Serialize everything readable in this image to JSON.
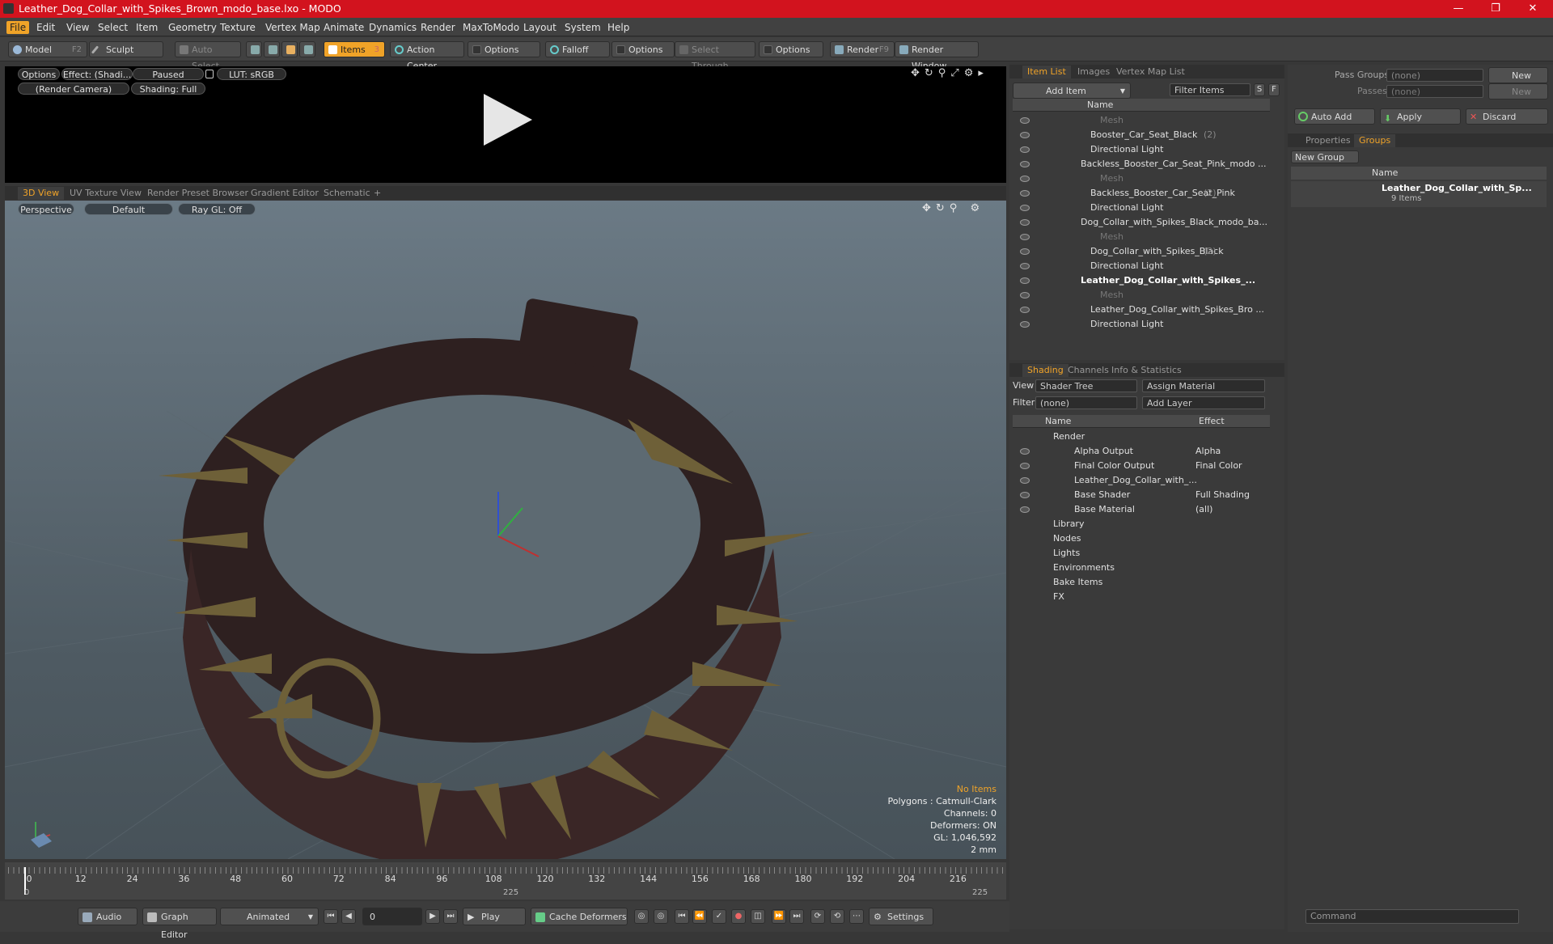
{
  "window": {
    "title": "Leather_Dog_Collar_with_Spikes_Brown_modo_base.lxo - MODO",
    "min": "—",
    "max": "❐",
    "close": "✕"
  },
  "menu": [
    "File",
    "Edit",
    "View",
    "Select",
    "Item",
    "Geometry",
    "Texture",
    "Vertex Map",
    "Animate",
    "Dynamics",
    "Render",
    "MaxToModo",
    "Layout",
    "System",
    "Help"
  ],
  "toolbar": {
    "model": "Model",
    "model_key": "F2",
    "sculpt": "Sculpt",
    "auto_select": "Auto Select",
    "items": "Items",
    "items_key": "3",
    "action_center": "Action Center",
    "options1": "Options",
    "falloff": "Falloff",
    "options2": "Options",
    "select_through": "Select Through",
    "options3": "Options",
    "render": "Render",
    "render_key": "F9",
    "render_window": "Render Window"
  },
  "render_view": {
    "options": "Options",
    "effect": "Effect: (Shadi...",
    "paused": "Paused",
    "lut": "LUT: sRGB",
    "camera": "(Render Camera)",
    "shading": "Shading: Full"
  },
  "view_tabs": [
    "3D View",
    "UV Texture View",
    "Render Preset Browser",
    "Gradient Editor",
    "Schematic"
  ],
  "viewport": {
    "projection": "Perspective",
    "style": "Default",
    "raygl": "Ray GL: Off",
    "stats": {
      "no_items": "No Items",
      "polygons": "Polygons : Catmull-Clark",
      "channels": "Channels: 0",
      "deformers": "Deformers: ON",
      "gl": "GL: 1,046,592",
      "scale": "2 mm"
    }
  },
  "timeline": {
    "major": [
      "0",
      "12",
      "24",
      "36",
      "48",
      "60",
      "72",
      "84",
      "96",
      "108",
      "120",
      "132",
      "144",
      "156",
      "168",
      "180",
      "192",
      "204",
      "216"
    ],
    "start": "0",
    "mid": "225",
    "end": "225"
  },
  "bottom": {
    "audio": "Audio",
    "graph_editor": "Graph Editor",
    "animated": "Animated",
    "frame": "0",
    "play": "Play",
    "cache": "Cache Deformers",
    "settings": "Settings"
  },
  "item_list": {
    "tabs": [
      "Item List",
      "Images",
      "Vertex Map List"
    ],
    "add_item": "Add Item",
    "filter": "Filter Items",
    "s": "S",
    "f": "F",
    "col_name": "Name",
    "rows": [
      {
        "label": "Mesh",
        "indent": 3,
        "style": "dim"
      },
      {
        "label": "Booster_Car_Seat_Black",
        "count": "(2)",
        "indent": 2,
        "style": ""
      },
      {
        "label": "Directional Light",
        "indent": 2,
        "style": ""
      },
      {
        "label": "Backless_Booster_Car_Seat_Pink_modo ...",
        "indent": 1,
        "style": ""
      },
      {
        "label": "Mesh",
        "indent": 3,
        "style": "dim"
      },
      {
        "label": "Backless_Booster_Car_Seat_Pink",
        "count": "(2)",
        "indent": 2,
        "style": ""
      },
      {
        "label": "Directional Light",
        "indent": 2,
        "style": ""
      },
      {
        "label": "Dog_Collar_with_Spikes_Black_modo_ba...",
        "indent": 1,
        "style": ""
      },
      {
        "label": "Mesh",
        "indent": 3,
        "style": "dim"
      },
      {
        "label": "Dog_Collar_with_Spikes_Black",
        "count": "(2)",
        "indent": 2,
        "style": ""
      },
      {
        "label": "Directional Light",
        "indent": 2,
        "style": ""
      },
      {
        "label": "Leather_Dog_Collar_with_Spikes_...",
        "indent": 1,
        "style": "bold"
      },
      {
        "label": "Mesh",
        "indent": 3,
        "style": "dim"
      },
      {
        "label": "Leather_Dog_Collar_with_Spikes_Bro ...",
        "indent": 2,
        "style": ""
      },
      {
        "label": "Directional Light",
        "indent": 2,
        "style": ""
      }
    ]
  },
  "shading": {
    "tabs": [
      "Shading",
      "Channels",
      "Info & Statistics"
    ],
    "view_label": "View",
    "view_value": "Shader Tree",
    "assign": "Assign Material",
    "f": "F",
    "filter_label": "Filter",
    "filter_value": "(none)",
    "add_layer": "Add Layer",
    "s": "S",
    "col_name": "Name",
    "col_effect": "Effect",
    "rows": [
      {
        "label": "Render",
        "effect": "",
        "indent": 0
      },
      {
        "label": "Alpha Output",
        "effect": "Alpha",
        "indent": 1
      },
      {
        "label": "Final Color Output",
        "effect": "Final Color",
        "indent": 1
      },
      {
        "label": "Leather_Dog_Collar_with_...",
        "effect": "",
        "indent": 1
      },
      {
        "label": "Base Shader",
        "effect": "Full Shading",
        "indent": 1
      },
      {
        "label": "Base Material",
        "effect": "(all)",
        "indent": 1
      },
      {
        "label": "Library",
        "effect": "",
        "indent": 0
      },
      {
        "label": "Nodes",
        "effect": "",
        "indent": 0
      },
      {
        "label": "Lights",
        "effect": "",
        "indent": 0
      },
      {
        "label": "Environments",
        "effect": "",
        "indent": 0
      },
      {
        "label": "Bake Items",
        "effect": "",
        "indent": 0
      },
      {
        "label": "FX",
        "effect": "",
        "indent": 0
      }
    ]
  },
  "groups": {
    "pass_groups": "Pass Groups",
    "pass_value": "(none)",
    "new": "New",
    "passes": "Passes",
    "passes_value": "(none)",
    "new2": "New",
    "auto_add": "Auto Add",
    "apply": "Apply",
    "discard": "Discard",
    "tabs": [
      "Properties",
      "Groups"
    ],
    "new_group": "New Group",
    "col_name": "Name",
    "group_name": "Leather_Dog_Collar_with_Sp...",
    "group_count": "9 Items"
  },
  "command": {
    "placeholder": "Command"
  },
  "colors": {
    "accent": "#f0a328",
    "titlebar": "#d2131e"
  }
}
